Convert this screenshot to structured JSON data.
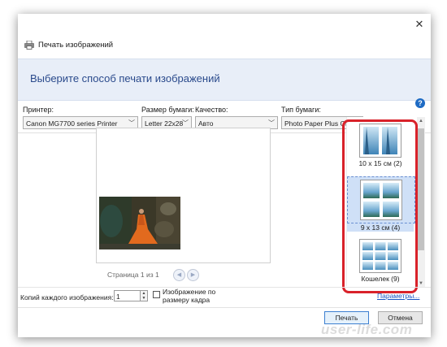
{
  "dialog": {
    "title": "Печать изображений",
    "banner": "Выберите способ печати изображений",
    "close_glyph": "✕"
  },
  "fields": {
    "printer": {
      "label": "Принтер:",
      "value": "Canon MG7700 series Printer"
    },
    "paper_size": {
      "label": "Размер бумаги:",
      "value": "Letter 22x28"
    },
    "quality": {
      "label": "Качество:",
      "value": "Авто"
    },
    "paper_type": {
      "label": "Тип бумаги:",
      "value": "Photo Paper Plus Gloss"
    }
  },
  "help": {
    "glyph": "?"
  },
  "preview": {
    "page_text": "Страница 1 из 1",
    "prev_glyph": "◀",
    "next_glyph": "▶"
  },
  "layouts": [
    {
      "label": "10 x 15 см (2)",
      "selected": false
    },
    {
      "label": "9 x 13 см (4)",
      "selected": true
    },
    {
      "label": "Кошелек (9)",
      "selected": false
    }
  ],
  "copies": {
    "label": "Копий каждого изображения:",
    "value": "1",
    "spin_up": "▲",
    "spin_down": "▼"
  },
  "fit": {
    "label": "Изображение по размеру кадра",
    "checked": false
  },
  "params_link": "Параметры...",
  "buttons": {
    "print": "Печать",
    "cancel": "Отмена"
  },
  "scroll": {
    "up": "▲",
    "down": "▼"
  },
  "watermark": "user-life.com",
  "colors": {
    "highlight": "#d9222a",
    "banner_text": "#2a4a8c",
    "accent": "#1e6bc4"
  }
}
